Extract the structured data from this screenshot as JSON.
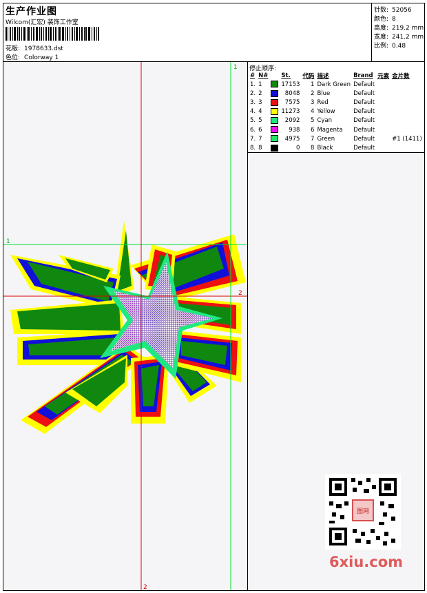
{
  "header": {
    "title": "生产作业图",
    "studio": "Wilcom(汇宏) 装饰工作室",
    "file_label": "花版:",
    "file_value": "1978633.dst",
    "colorway_label": "色位:",
    "colorway_value": "Colorway 1"
  },
  "stats": [
    {
      "label": "针数:",
      "value": "52056"
    },
    {
      "label": "颜色:",
      "value": "8"
    },
    {
      "label": "高度:",
      "value": "219.2 mm"
    },
    {
      "label": "宽度:",
      "value": "241.2 mm"
    },
    {
      "label": "比例:",
      "value": "0.48"
    }
  ],
  "guides": {
    "h1": "1",
    "h2": "2",
    "v1": "1",
    "v2": "2"
  },
  "stop_sequence": {
    "title": "停止顺序:",
    "headers": [
      "#",
      "N#",
      "St.",
      "代码",
      "描述",
      "Brand",
      "元素",
      "金片数"
    ],
    "rows": [
      {
        "idx": "1.",
        "n": "1",
        "color": "#108810",
        "st": "17153",
        "code": "1",
        "desc": "Dark Green",
        "brand": "Default",
        "el": "",
        "seq": ""
      },
      {
        "idx": "2.",
        "n": "2",
        "color": "#1010d8",
        "st": "8048",
        "code": "2",
        "desc": "Blue",
        "brand": "Default",
        "el": "",
        "seq": ""
      },
      {
        "idx": "3.",
        "n": "3",
        "color": "#ee1010",
        "st": "7575",
        "code": "3",
        "desc": "Red",
        "brand": "Default",
        "el": "",
        "seq": ""
      },
      {
        "idx": "4.",
        "n": "4",
        "color": "#ffff00",
        "st": "11273",
        "code": "4",
        "desc": "Yellow",
        "brand": "Default",
        "el": "",
        "seq": ""
      },
      {
        "idx": "5.",
        "n": "5",
        "color": "#20e880",
        "st": "2092",
        "code": "5",
        "desc": "Cyan",
        "brand": "Default",
        "el": "",
        "seq": ""
      },
      {
        "idx": "6.",
        "n": "6",
        "color": "#ee10ee",
        "st": "938",
        "code": "6",
        "desc": "Magenta",
        "brand": "Default",
        "el": "",
        "seq": ""
      },
      {
        "idx": "7.",
        "n": "7",
        "color": "#20e860",
        "st": "4975",
        "code": "7",
        "desc": "Green",
        "brand": "Default",
        "el": "",
        "seq": "#1 (1411)"
      },
      {
        "idx": "8.",
        "n": "8",
        "color": "#000000",
        "st": "0",
        "code": "8",
        "desc": "Black",
        "brand": "Default",
        "el": "",
        "seq": ""
      }
    ]
  },
  "watermark": "6xiu.com",
  "qr_stamp": "图网"
}
